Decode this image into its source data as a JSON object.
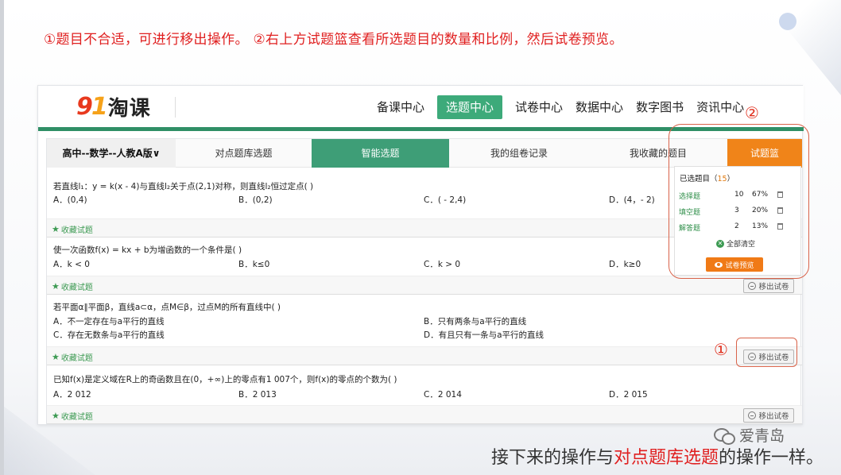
{
  "instruction": "①题目不合适，可进行移出操作。   ②右上方试题篮查看所选题目的数量和比例，然后试卷预览。",
  "annotations": {
    "one": "①",
    "two": "②"
  },
  "bottom_note": {
    "pre": "接下来的操作与",
    "highlight": "对点题库选题",
    "post": "的操作一样。"
  },
  "watermark": "爱青岛",
  "app": {
    "logo": {
      "num_a": "9",
      "num_b": "1",
      "text": "淘课"
    },
    "nav": [
      "备课中心",
      "选题中心",
      "试卷中心",
      "数据中心",
      "数字图书",
      "资讯中心"
    ],
    "nav_active": "选题中心",
    "tabs": {
      "subject": "高中--数学--人教A版∨",
      "t1": "对点题库选题",
      "t2": "智能选题",
      "t3": "我的组卷记录",
      "t4": "我收藏的题目",
      "basket": "试题篮"
    },
    "fav_label": "收藏试题",
    "remove_label": "移出试卷",
    "questions": [
      {
        "stem": "若直线l₁：y = k(x - 4)与直线l₂关于点(2,1)对称，则直线l₂恒过定点(      )",
        "options": [
          "A．(0,4)",
          "B．(0,2)",
          "C．( - 2,4)",
          "D．(4，- 2)"
        ]
      },
      {
        "stem": "使一次函数f(x) = kx + b为增函数的一个条件是(      )",
        "options": [
          "A．k < 0",
          "B．k≤0",
          "C．k > 0",
          "D．k≥0"
        ]
      },
      {
        "stem": "若平面α∥平面β，直线a⊂α，点M∈β，过点M的所有直线中(      )",
        "options": [
          "A．不一定存在与a平行的直线",
          "B．只有两条与a平行的直线",
          "C．存在无数条与a平行的直线",
          "D．有且只有一条与a平行的直线"
        ]
      },
      {
        "stem": "已知f(x)是定义域在R上的奇函数且在(0，+∞)上的零点有1 007个，则f(x)的零点的个数为(      )",
        "options": [
          "A．2 012",
          "B．2 013",
          "C．2 014",
          "D．2 015"
        ]
      }
    ],
    "basket": {
      "title_pre": "已选题目（",
      "count": "15",
      "title_post": "）",
      "rows": [
        {
          "type": "选择题",
          "num": "10",
          "pct": "67%"
        },
        {
          "type": "填空题",
          "num": "3",
          "pct": "20%"
        },
        {
          "type": "解答题",
          "num": "2",
          "pct": "13%"
        }
      ],
      "clear": "全部清空",
      "preview": "试卷预览"
    }
  },
  "colors": {
    "accent_green": "#3daa7a",
    "basket_orange": "#f08419",
    "annotation_red": "#e02020"
  }
}
